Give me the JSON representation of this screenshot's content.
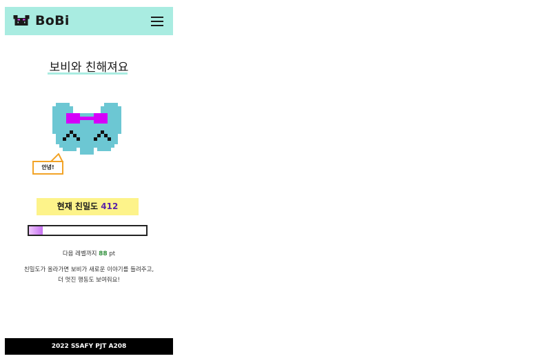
{
  "header": {
    "logo_text": "BoBi",
    "logo_icon": "bobi-logo-icon",
    "menu_icon": "hamburger-menu-icon"
  },
  "page": {
    "title": "보비와 친해져요"
  },
  "character": {
    "speech": "안녕!"
  },
  "intimacy": {
    "label": "현재 친밀도",
    "value": "412"
  },
  "progress": {
    "fraction": 0.12,
    "fill_color_start": "#f0c7ff",
    "fill_color_end": "#c671f0"
  },
  "next_level": {
    "prefix": "다음 레벨까지",
    "points": "88",
    "unit": "pt"
  },
  "description": {
    "line1": "친밀도가 올라가면 보비가 새로운 이야기를 들려주고,",
    "line2": "더 멋진 행동도 보여줘요!"
  },
  "footer": {
    "text": "2022 SSAFY PJT A208"
  },
  "colors": {
    "header_bg": "#a9ece1",
    "intimacy_bg": "#fdf38a",
    "bubble_border": "#f2a326",
    "character_body": "#6cc7d3",
    "character_glasses": "#d500f9"
  }
}
